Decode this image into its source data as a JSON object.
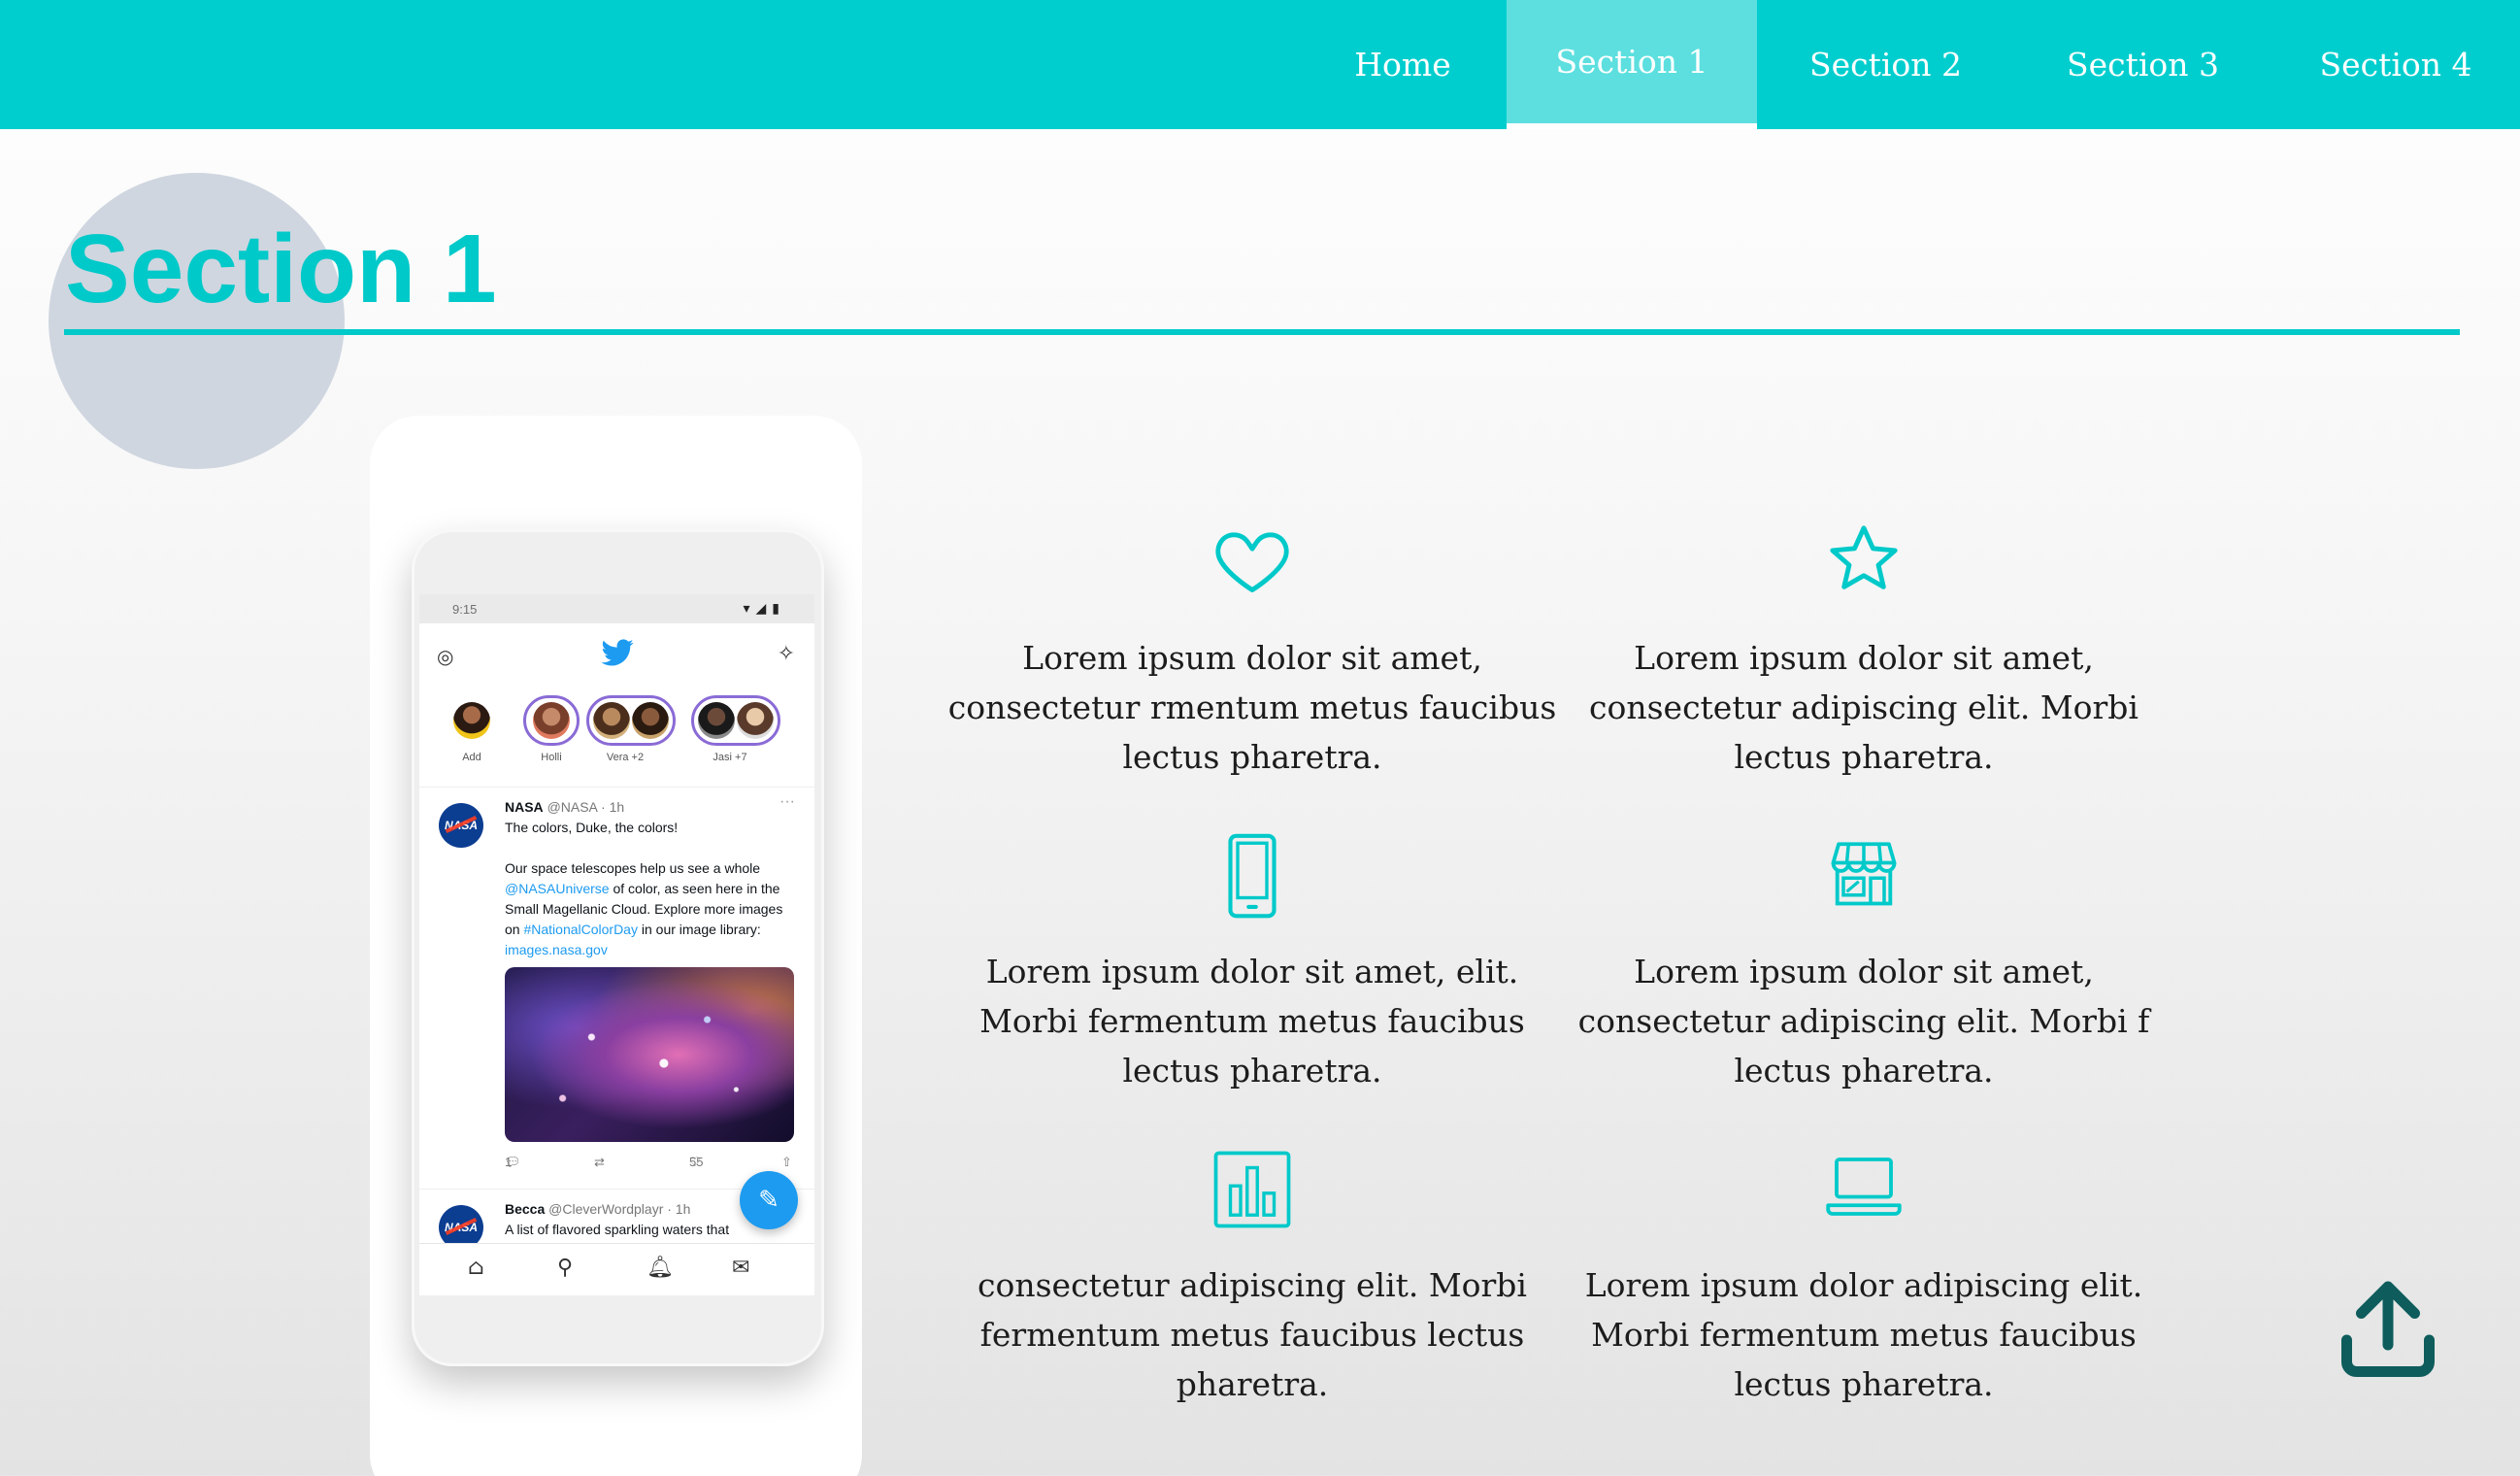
{
  "nav": {
    "items": [
      {
        "label": "Home",
        "active": false
      },
      {
        "label": "Section 1",
        "active": true
      },
      {
        "label": "Section 2",
        "active": false
      },
      {
        "label": "Section 3",
        "active": false
      },
      {
        "label": "Section 4",
        "active": false
      }
    ]
  },
  "section": {
    "title": "Section 1"
  },
  "phone": {
    "status_time": "9:15",
    "fleets": [
      {
        "label": "Add"
      },
      {
        "label": "Holli"
      },
      {
        "label": "Vera +2"
      },
      {
        "label": "Jasi +7"
      }
    ],
    "tweets": [
      {
        "avatar": "NASA",
        "name": "NASA",
        "handle": "@NASA · 1h",
        "line1": "The colors, Duke, the colors!",
        "body_pre": "Our space telescopes help us see a whole ",
        "link1": "@NASAUniverse",
        "body_mid": " of color, as seen here in the Small Magellanic Cloud. Explore more images on ",
        "link2": "#NationalColorDay",
        "body_post": " in our image library: ",
        "link3": "images.nasa.gov",
        "replies": "1",
        "likes": "55"
      },
      {
        "avatar": "NASA",
        "name": "Becca",
        "handle": "@CleverWordplayr · 1h",
        "line1": "A list of flavored sparkling waters that"
      }
    ]
  },
  "features": [
    {
      "icon": "heart-icon",
      "text": "Lorem ipsum dolor sit amet, consectetur rmentum metus faucibus lectus pharetra."
    },
    {
      "icon": "star-icon",
      "text": "Lorem ipsum dolor sit amet, consectetur adipiscing elit. Morbi lectus pharetra."
    },
    {
      "icon": "mobile-phone-icon",
      "text": "Lorem ipsum dolor sit amet, elit. Morbi fermentum metus faucibus lectus pharetra."
    },
    {
      "icon": "store-icon",
      "text": "Lorem ipsum dolor sit amet, consectetur adipiscing elit. Morbi f lectus pharetra."
    },
    {
      "icon": "bar-chart-icon",
      "text": "consectetur adipiscing elit. Morbi fermentum metus faucibus lectus pharetra."
    },
    {
      "icon": "laptop-icon",
      "text": "Lorem ipsum dolor adipiscing elit. Morbi fermentum metus faucibus lectus pharetra."
    }
  ],
  "colors": {
    "primary": "#00cece",
    "nav_active": "#5ddfdf",
    "heading": "#00c9c9",
    "upload_icon": "#0e5c5c"
  }
}
